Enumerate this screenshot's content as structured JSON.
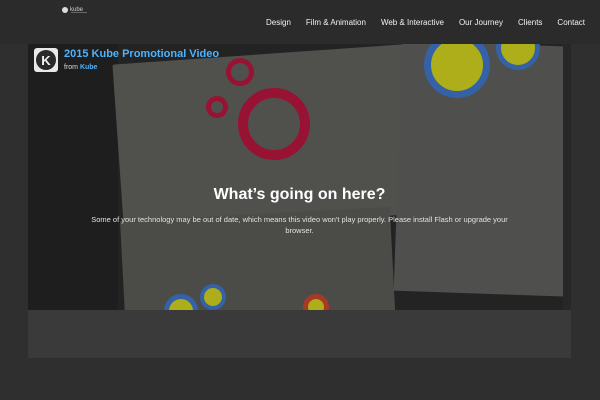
{
  "header": {
    "logo_text": "kube",
    "nav": [
      {
        "label": "Design"
      },
      {
        "label": "Film & Animation"
      },
      {
        "label": "Web & Interactive"
      },
      {
        "label": "Our Journey"
      },
      {
        "label": "Clients"
      },
      {
        "label": "Contact"
      }
    ]
  },
  "video": {
    "title": "2015 Kube Promotional Video",
    "from_label": "from",
    "author": "Kube",
    "portrait_letter": "K",
    "message_heading": "What’s going on here?",
    "message_body": "Some of your technology may be out of date, which means this video won't play properly. Please install Flash or upgrade your browser."
  },
  "colors": {
    "accent": "#4db3ff",
    "ring_red": "#c0123a",
    "ring_yellow": "#cfcf1f"
  }
}
